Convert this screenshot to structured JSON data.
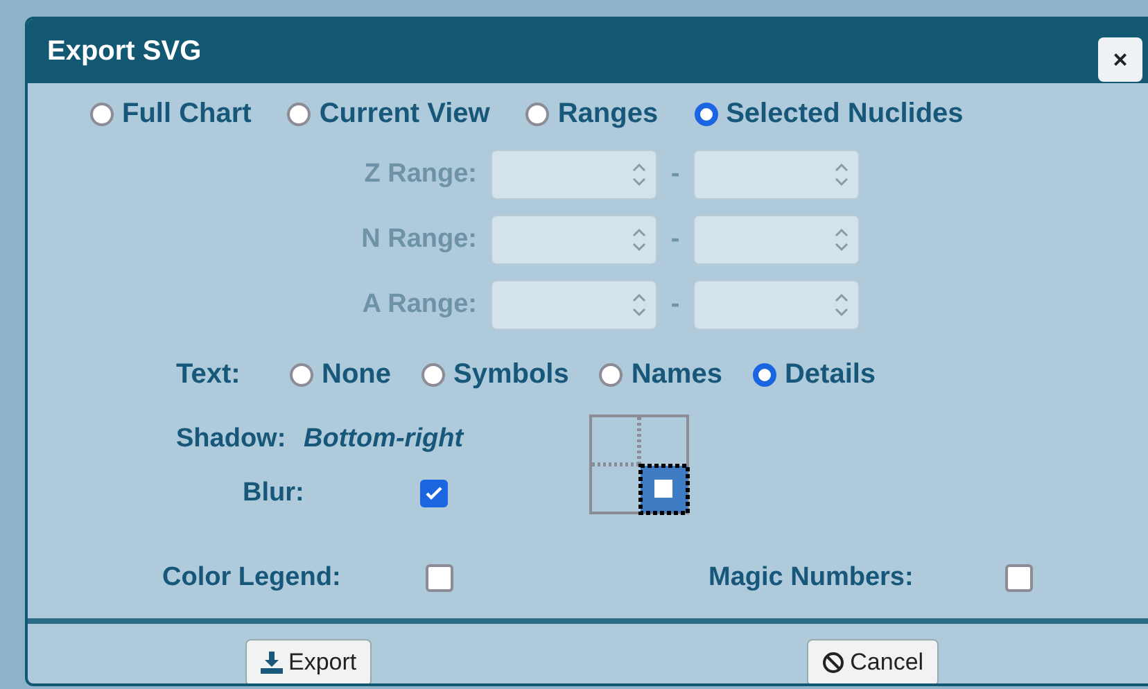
{
  "dialog": {
    "title": "Export SVG",
    "close_label": "×",
    "scope_options": [
      {
        "label": "Full Chart",
        "selected": false
      },
      {
        "label": "Current View",
        "selected": false
      },
      {
        "label": "Ranges",
        "selected": false
      },
      {
        "label": "Selected Nuclides",
        "selected": true
      }
    ],
    "ranges": [
      {
        "label": "Z Range:",
        "separator": "-",
        "disabled": true
      },
      {
        "label": "N Range:",
        "separator": "-",
        "disabled": true
      },
      {
        "label": "A Range:",
        "separator": "-",
        "disabled": true
      }
    ],
    "text_label": "Text:",
    "text_options": [
      {
        "label": "None",
        "selected": false
      },
      {
        "label": "Symbols",
        "selected": false
      },
      {
        "label": "Names",
        "selected": false
      },
      {
        "label": "Details",
        "selected": true
      }
    ],
    "shadow": {
      "label": "Shadow:",
      "value": "Bottom-right"
    },
    "blur": {
      "label": "Blur:",
      "checked": true
    },
    "color_legend": {
      "label": "Color Legend:",
      "checked": false
    },
    "magic_numbers": {
      "label": "Magic Numbers:",
      "checked": false
    },
    "buttons": [
      {
        "label": "Export",
        "kind": "export"
      },
      {
        "label": "Cancel",
        "kind": "cancel"
      }
    ]
  }
}
